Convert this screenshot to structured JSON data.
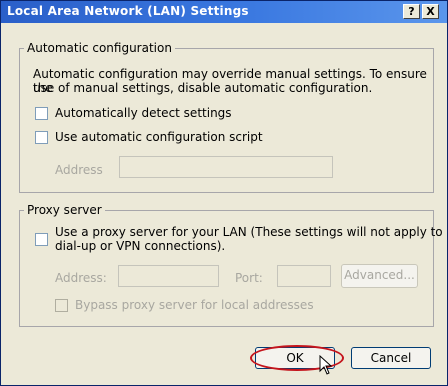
{
  "window": {
    "title": "Local Area Network (LAN) Settings",
    "help_label": "?",
    "close_label": "X"
  },
  "auto_config": {
    "legend": "Automatic configuration",
    "description_line1": "Automatic configuration may override manual settings.  To ensure the",
    "description_line2": "use of manual settings, disable automatic configuration.",
    "detect_label": "Automatically detect settings",
    "detect_checked": false,
    "script_label": "Use automatic configuration script",
    "script_checked": false,
    "address_label": "Address",
    "address_value": ""
  },
  "proxy": {
    "legend": "Proxy server",
    "use_proxy_line1": "Use a proxy server for your LAN (These settings will not apply to",
    "use_proxy_line2": "dial-up or VPN connections).",
    "use_proxy_checked": false,
    "address_label": "Address:",
    "address_value": "",
    "port_label": "Port:",
    "port_value": "",
    "advanced_label": "Advanced...",
    "bypass_label": "Bypass proxy server for local addresses",
    "bypass_checked": false
  },
  "buttons": {
    "ok_label": "OK",
    "cancel_label": "Cancel"
  },
  "colors": {
    "title_bar": "#2a5fc9",
    "dialog_bg": "#ece9d8",
    "highlight_ring": "#c4141c"
  }
}
